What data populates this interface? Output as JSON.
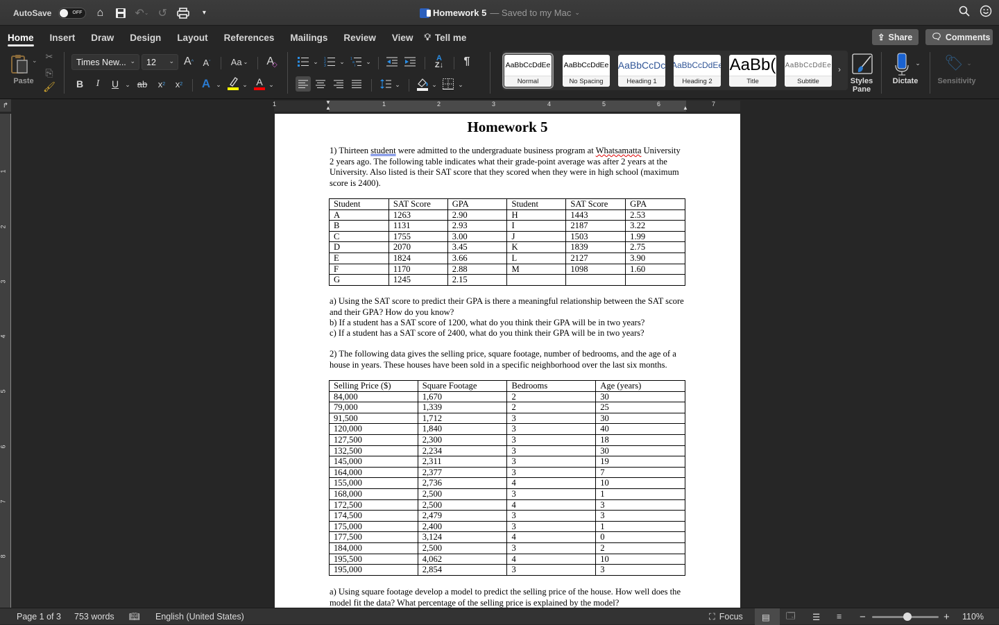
{
  "titlebar": {
    "autosave_label": "AutoSave",
    "autosave_state": "OFF",
    "doc_title": "Homework 5",
    "doc_status": "— Saved to my Mac",
    "quick_access": [
      "home-icon",
      "save-icon",
      "undo-icon",
      "redo-icon",
      "print-icon",
      "customize-icon"
    ]
  },
  "ribbon": {
    "tabs": [
      {
        "label": "Home",
        "active": true
      },
      {
        "label": "Insert"
      },
      {
        "label": "Draw"
      },
      {
        "label": "Design"
      },
      {
        "label": "Layout"
      },
      {
        "label": "References"
      },
      {
        "label": "Mailings"
      },
      {
        "label": "Review"
      },
      {
        "label": "View"
      }
    ],
    "tell_me": "Tell me",
    "share_label": "Share",
    "comments_label": "Comments"
  },
  "toolbar": {
    "paste_label": "Paste",
    "font_name": "Times New...",
    "font_size": "12",
    "highlight_color": "#ffff00",
    "font_color": "#ff0000",
    "styles": [
      {
        "sample": "AaBbCcDdEe",
        "name": "Normal",
        "selected": true
      },
      {
        "sample": "AaBbCcDdEe",
        "name": "No Spacing"
      },
      {
        "sample": "AaBbCcDc",
        "name": "Heading 1"
      },
      {
        "sample": "AaBbCcDdEe",
        "name": "Heading 2"
      },
      {
        "sample": "AaBb(",
        "name": "Title"
      },
      {
        "sample": "AaBbCcDdEe",
        "name": "Subtitle"
      }
    ],
    "styles_pane_label": "Styles Pane",
    "dictate_label": "Dictate",
    "sensitivity_label": "Sensitivity"
  },
  "ruler": {
    "h_numbers": [
      "1",
      "1",
      "2",
      "3",
      "4",
      "5",
      "6",
      "7"
    ],
    "v_numbers": [
      "1",
      "2",
      "3",
      "4",
      "5",
      "6",
      "7",
      "8"
    ]
  },
  "document": {
    "title": "Homework 5",
    "q1_intro_before": "1) Thirteen ",
    "q1_intro_gram": "student",
    "q1_intro_mid": " were admitted to the undergraduate business program at ",
    "q1_intro_spell": "Whatsamatta",
    "q1_intro_after": " University 2 years ago. The following table indicates what their grade-point average was after 2 years at the University. Also listed is their SAT score that they scored when they were in high school (maximum score is 2400).",
    "table1": {
      "headers": [
        "Student",
        "SAT Score",
        "GPA",
        "Student",
        "SAT Score",
        "GPA"
      ],
      "rows": [
        [
          "A",
          "1263",
          "2.90",
          "H",
          "1443",
          "2.53"
        ],
        [
          "B",
          "1131",
          "2.93",
          "I",
          "2187",
          "3.22"
        ],
        [
          "C",
          "1755",
          "3.00",
          "J",
          "1503",
          "1.99"
        ],
        [
          "D",
          "2070",
          "3.45",
          "K",
          "1839",
          "2.75"
        ],
        [
          "E",
          "1824",
          "3.66",
          "L",
          "2127",
          "3.90"
        ],
        [
          "F",
          "1170",
          "2.88",
          "M",
          "1098",
          "1.60"
        ],
        [
          "G",
          "1245",
          "2.15",
          "",
          "",
          ""
        ]
      ]
    },
    "q1_a": "a) Using the SAT score to predict their GPA is there a meaningful relationship between the SAT score and their GPA? How do you know?",
    "q1_b": "b) If a student has a SAT score of 1200, what do you think their GPA will be in two years?",
    "q1_c": "c) If a student has a SAT score of 2400, what do you think their GPA will be in two years?",
    "q2_intro": "2) The following data gives the selling price, square footage, number of bedrooms, and the age of a house in years. These houses have been sold in a specific neighborhood over the last six months.",
    "table2": {
      "headers": [
        "Selling Price ($)",
        "Square Footage",
        "Bedrooms",
        "Age (years)"
      ],
      "rows": [
        [
          "84,000",
          "1,670",
          "2",
          "30"
        ],
        [
          "79,000",
          "1,339",
          "2",
          "25"
        ],
        [
          "91,500",
          "1,712",
          "3",
          "30"
        ],
        [
          "120,000",
          "1,840",
          "3",
          "40"
        ],
        [
          "127,500",
          "2,300",
          "3",
          "18"
        ],
        [
          "132,500",
          "2,234",
          "3",
          "30"
        ],
        [
          "145,000",
          "2,311",
          "3",
          "19"
        ],
        [
          "164,000",
          "2,377",
          "3",
          "7"
        ],
        [
          "155,000",
          "2,736",
          "4",
          "10"
        ],
        [
          "168,000",
          "2,500",
          "3",
          "1"
        ],
        [
          "172,500",
          "2,500",
          "4",
          "3"
        ],
        [
          "174,500",
          "2,479",
          "3",
          "3"
        ],
        [
          "175,000",
          "2,400",
          "3",
          "1"
        ],
        [
          "177,500",
          "3,124",
          "4",
          "0"
        ],
        [
          "184,000",
          "2,500",
          "3",
          "2"
        ],
        [
          "195,500",
          "4,062",
          "4",
          "10"
        ],
        [
          "195,000",
          "2,854",
          "3",
          "3"
        ]
      ]
    },
    "q2_a": "a) Using square footage develop a model to predict the selling price of the house. How well does the model fit the data? What percentage of the selling price is explained by the model?"
  },
  "statusbar": {
    "page": "Page 1 of 3",
    "words": "753 words",
    "language": "English (United States)",
    "focus": "Focus",
    "zoom": "110%",
    "zoom_value_percent": 110
  }
}
